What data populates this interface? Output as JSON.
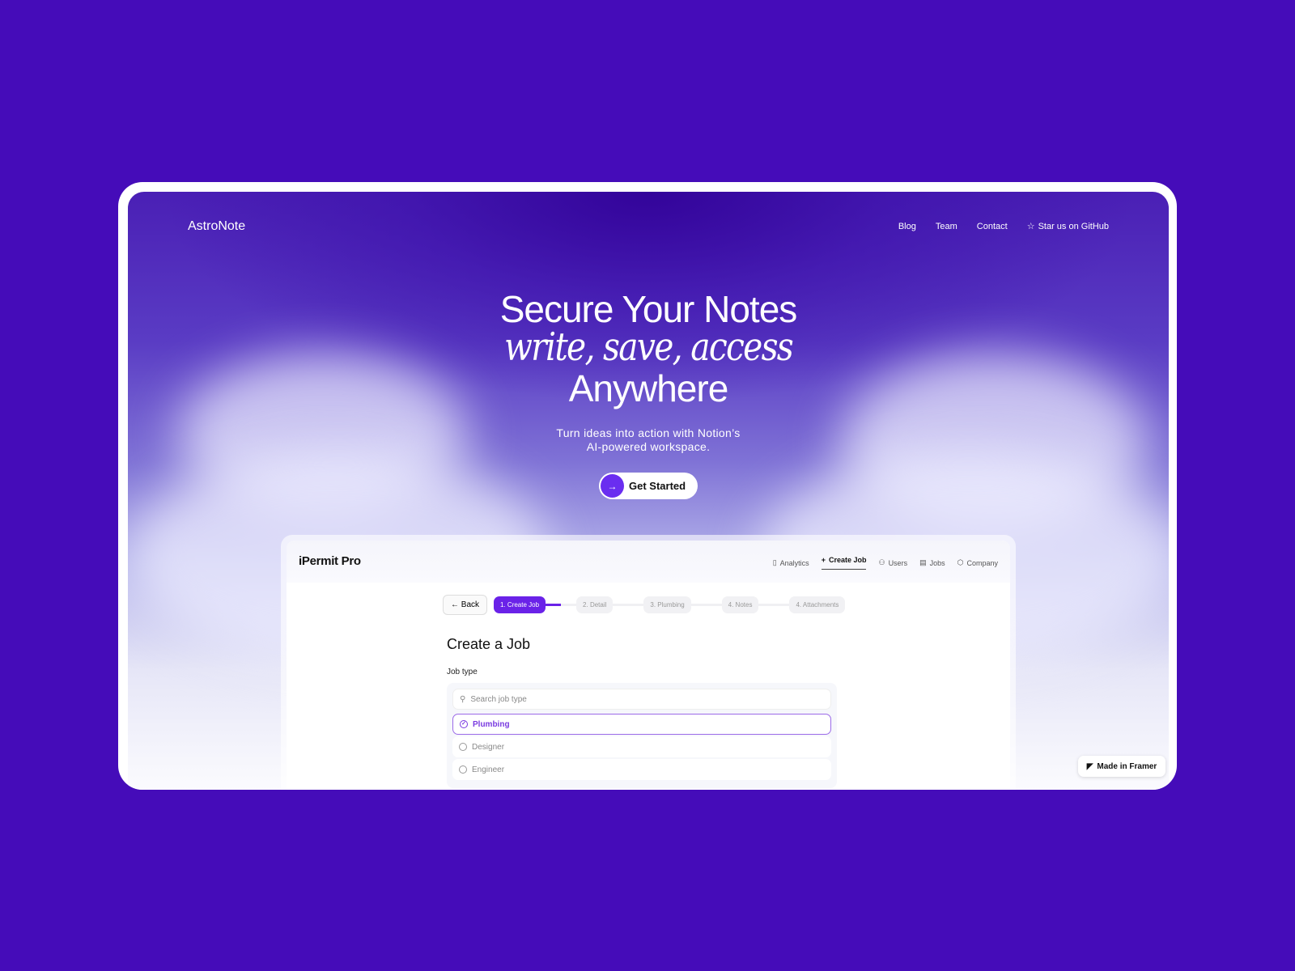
{
  "site": {
    "logo": "AstroNote",
    "nav": [
      "Blog",
      "Team",
      "Contact",
      "Star us on GitHub"
    ]
  },
  "hero": {
    "line1": "Secure Your Notes",
    "line2": "write, save, access",
    "line3": "Anywhere",
    "sub1": "Turn ideas into action with Notion’s",
    "sub2": "AI-powered workspace.",
    "cta": "Get Started"
  },
  "app": {
    "name": "iPermit Pro",
    "nav": [
      "Analytics",
      "Create Job",
      "Users",
      "Jobs",
      "Company"
    ],
    "active_nav": "Create Job",
    "back": "Back",
    "steps": [
      "1. Create Job",
      "2. Detail",
      "3. Plumbing",
      "4. Notes",
      "4. Attachments"
    ],
    "progress_percent": 50,
    "title": "Create a Job",
    "field_label": "Job type",
    "search_placeholder": "Search job type",
    "options": [
      {
        "label": "Plumbing",
        "selected": true
      },
      {
        "label": "Designer",
        "selected": false
      },
      {
        "label": "Engineer",
        "selected": false
      }
    ]
  },
  "badge": "Made in Framer",
  "colors": {
    "background": "#450cb9",
    "accent": "#6a22e8"
  }
}
